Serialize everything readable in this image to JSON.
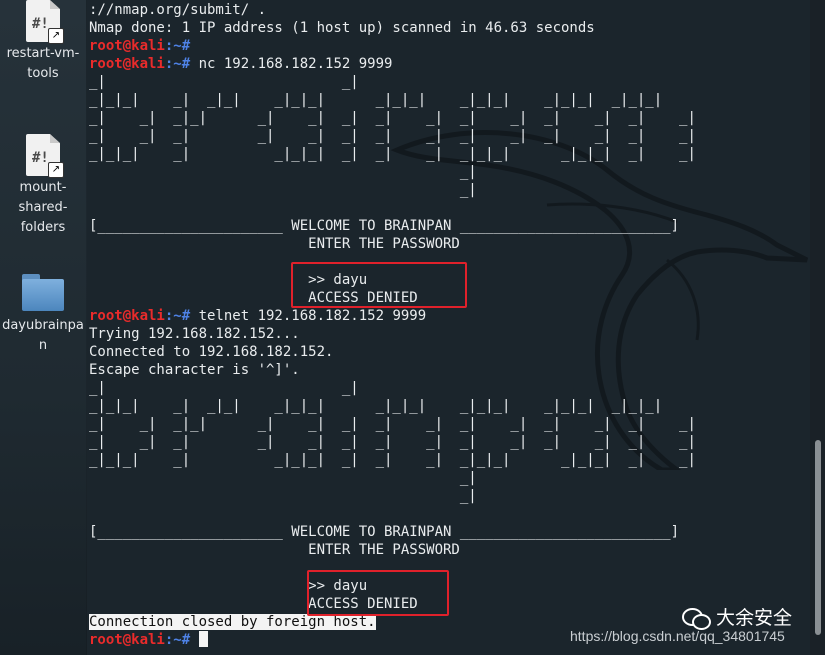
{
  "desktop": {
    "icons": [
      {
        "label": "restart-vm-tools",
        "icon": "shell-script-icon"
      },
      {
        "label": "mount-shared-folders",
        "icon": "shell-script-icon"
      },
      {
        "label": "dayubrainpan",
        "icon": "folder-icon"
      }
    ]
  },
  "prompt": {
    "user": "root@kali",
    "path": ":~# "
  },
  "terminal": {
    "l0": "://nmap.org/submit/ .",
    "l1": "Nmap done: 1 IP address (1 host up) scanned in 46.63 seconds",
    "cmd_nc": "nc 192.168.182.152 9999",
    "cmd_telnet": "telnet 192.168.182.152 9999",
    "trying": "Trying 192.168.182.152...",
    "connected": "Connected to 192.168.182.152.",
    "escape": "Escape character is '^]'.",
    "closed": "Connection closed by foreign host."
  },
  "banner": {
    "art": [
      "_|                            _|",
      "_|_|_|    _|  _|_|    _|_|_|      _|_|_|    _|_|_|    _|_|_|  _|_|_|",
      "_|    _|  _|_|      _|    _|  _|  _|    _|  _|    _|  _|    _|  _|    _|",
      "_|    _|  _|        _|    _|  _|  _|    _|  _|    _|  _|    _|  _|    _|",
      "_|_|_|    _|          _|_|_|  _|  _|    _|  _|_|_|      _|_|_|  _|    _|",
      "                                            _|",
      "                                            _|",
      ""
    ],
    "welcome": "[______________________ WELCOME TO BRAINPAN _________________________]",
    "enter": "                          ENTER THE PASSWORD",
    "blank": ""
  },
  "session": {
    "input": "                          >> dayu",
    "result": "                          ACCESS DENIED"
  },
  "watermark": {
    "brand": "大余安全",
    "url": "https://blog.csdn.net/qq_34801745"
  },
  "colors": {
    "prompt_user": "#ea2b2b",
    "prompt_path": "#4e82e6",
    "highlight_box": "#e0212b",
    "text": "#e9ecee"
  }
}
